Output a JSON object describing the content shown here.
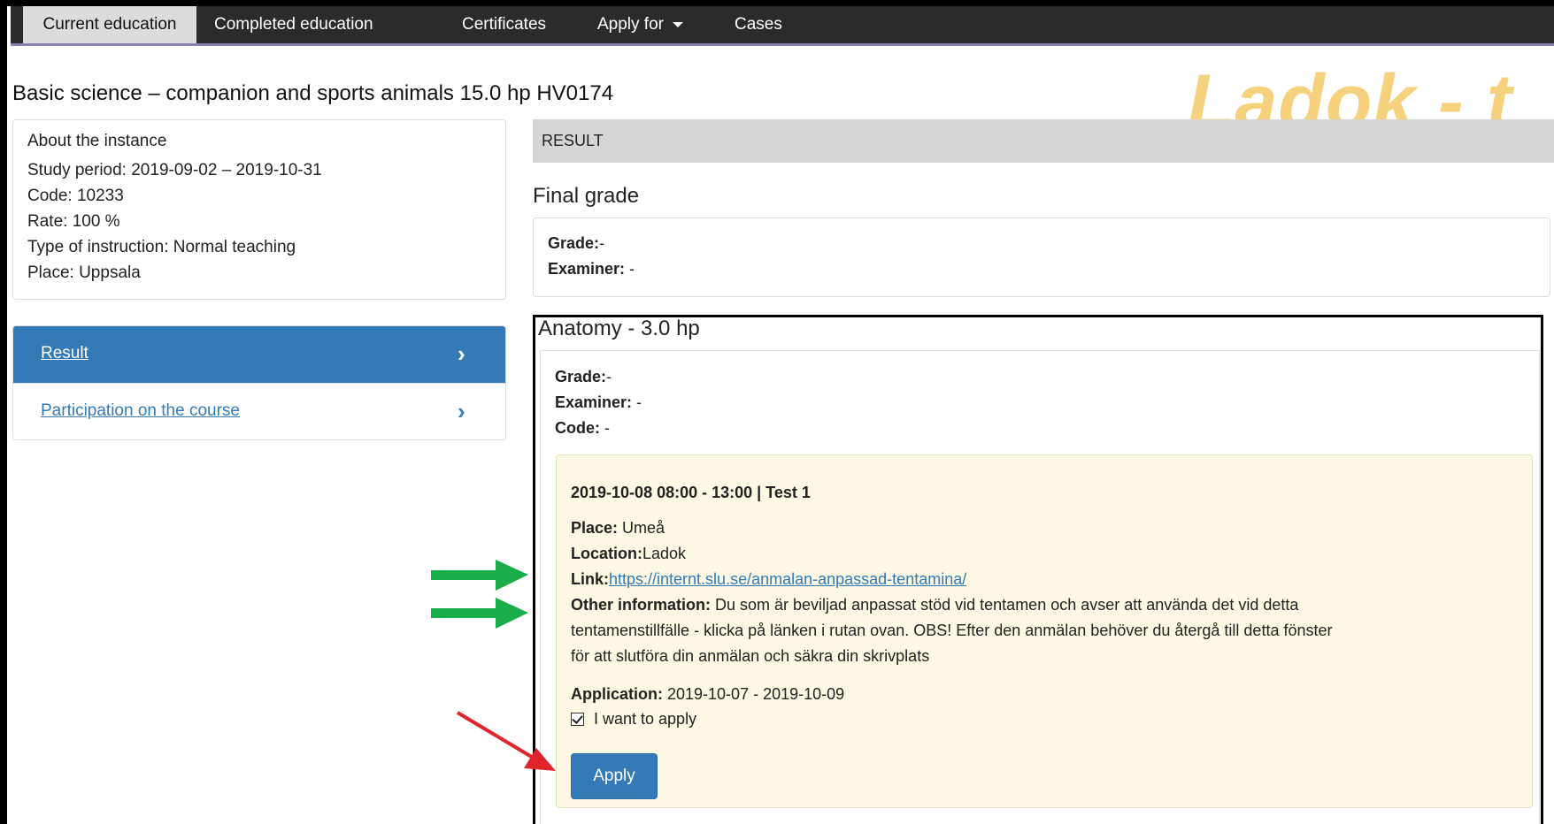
{
  "nav": {
    "tabs": [
      {
        "label": "Current education"
      },
      {
        "label": "Completed education"
      },
      {
        "label": "Certificates"
      },
      {
        "label": "Apply for"
      },
      {
        "label": "Cases"
      }
    ]
  },
  "watermark": "Ladok - t",
  "course": {
    "title": "Basic science – companion and sports animals 15.0 hp HV0174"
  },
  "about": {
    "heading": "About the instance",
    "study_period": "Study period:  2019-09-02 – 2019-10-31",
    "code": "Code:  10233",
    "rate": "Rate:  100 %",
    "type": "Type of instruction:  Normal teaching",
    "place": "Place:  Uppsala"
  },
  "leftnav": {
    "items": [
      {
        "label": "Result"
      },
      {
        "label": "Participation on the course"
      }
    ]
  },
  "result": {
    "header": "RESULT",
    "final_title": "Final grade",
    "grade_label": "Grade:",
    "grade_value": "-",
    "examiner_label": "Examiner:",
    "examiner_value": " -"
  },
  "module": {
    "title": "Anatomy - 3.0 hp",
    "grade_label": "Grade:",
    "grade_value": "-",
    "examiner_label": "Examiner:",
    "examiner_value": " -",
    "code_label": "Code:",
    "code_value": " -"
  },
  "exam": {
    "heading": "2019-10-08 08:00 - 13:00 | Test 1",
    "place_label": "Place:",
    "place_value": " Umeå",
    "location_label": "Location:",
    "location_value": "Ladok",
    "link_label": "Link:",
    "link_value": "https://internt.slu.se/anmalan-anpassad-tentamina/",
    "other_label": "Other information:",
    "other_line1": " Du som är beviljad anpassat stöd vid tentamen och avser att använda det vid detta",
    "other_line2": "tentamenstillfälle - klicka på länken i rutan ovan. OBS! Efter den anmälan behöver du återgå till detta fönster",
    "other_line3": "för att slutföra din anmälan och säkra din skrivplats",
    "application_label": "Application:",
    "application_value": " 2019-10-07 - 2019-10-09",
    "checkbox_label": "I want to apply",
    "checked": true,
    "apply_button": "Apply"
  },
  "colors": {
    "primary": "#337ab7",
    "exam_bg": "#fcf8e3",
    "green_arrow": "#1aad4b",
    "red_arrow": "#e0242b"
  }
}
